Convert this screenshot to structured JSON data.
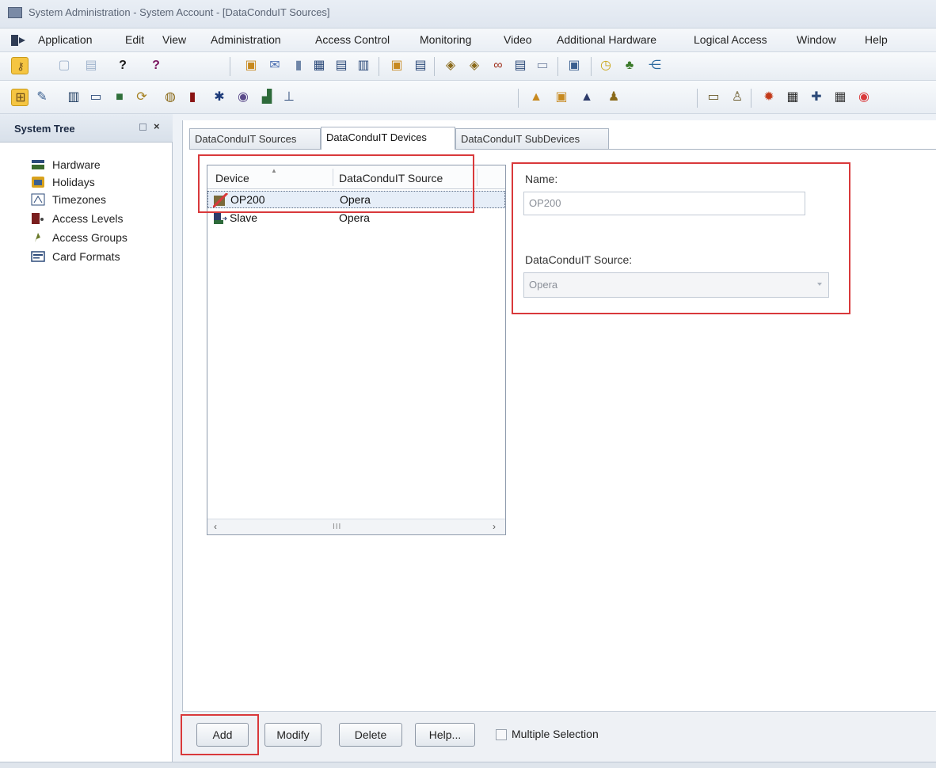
{
  "window": {
    "title": "System Administration - System Account - [DataConduIT Sources]"
  },
  "menu": [
    "Application",
    "Edit",
    "View",
    "Administration",
    "Access Control",
    "Monitoring",
    "Video",
    "Additional Hardware",
    "Logical Access",
    "Window",
    "Help"
  ],
  "tree": {
    "title": "System Tree",
    "close": "×",
    "items": [
      {
        "label": "Hardware",
        "icon": "hardware-icon"
      },
      {
        "label": "Holidays",
        "icon": "holidays-icon"
      },
      {
        "label": "Timezones",
        "icon": "timezones-icon"
      },
      {
        "label": "Access Levels",
        "icon": "access-levels-icon"
      },
      {
        "label": "Access Groups",
        "icon": "access-groups-icon"
      },
      {
        "label": "Card Formats",
        "icon": "card-formats-icon"
      }
    ]
  },
  "tabs": [
    {
      "label": "DataConduIT Sources",
      "active": false
    },
    {
      "label": "DataConduIT Devices",
      "active": true
    },
    {
      "label": "DataConduIT SubDevices",
      "active": false
    }
  ],
  "list": {
    "columns": [
      "Device",
      "DataConduIT Source"
    ],
    "rows": [
      {
        "device": "OP200",
        "source": "Opera",
        "selected": true,
        "icon": "device-error-icon"
      },
      {
        "device": "Slave",
        "source": "Opera",
        "selected": false,
        "icon": "device-icon"
      }
    ],
    "scroll_left": "‹",
    "scroll_thumb": "III",
    "scroll_right": "›"
  },
  "form": {
    "name_label": "Name:",
    "name_value": "OP200",
    "source_label": "DataConduIT Source:",
    "source_value": "Opera"
  },
  "buttons": {
    "add": "Add",
    "modify": "Modify",
    "delete": "Delete",
    "help": "Help...",
    "multiple_selection": "Multiple Selection"
  },
  "colors": {
    "highlight": "#d9393b",
    "selected_tool": "#f5c542"
  }
}
